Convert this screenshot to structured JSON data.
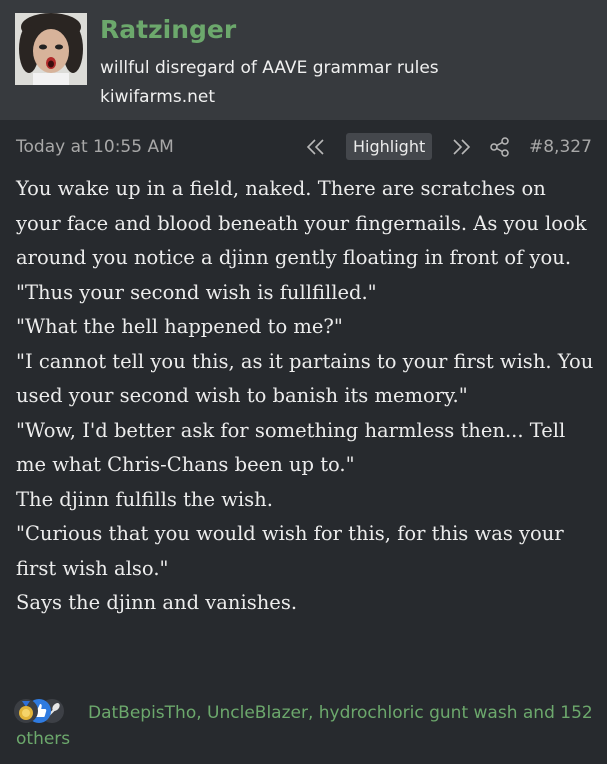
{
  "user": {
    "name": "Ratzinger",
    "title": "willful disregard of AAVE grammar rules",
    "banner": "kiwifarms.net"
  },
  "meta": {
    "timestamp": "Today at 10:55 AM",
    "highlight_label": "Highlight",
    "post_number": "#8,327"
  },
  "body": {
    "paragraphs": [
      "You wake up in a field, naked. There are scratches on your face and blood beneath your fingernails. As you look around you notice a djinn gently floating in front of you.",
      "\"Thus your second wish is fullfilled.\"",
      "\"What the hell happened to me?\"",
      "\"I cannot tell you this, as it partains to your first wish. You used your second wish to banish its memory.\"",
      "\"Wow, I'd better ask for something harmless then... Tell me what Chris-Chans been up to.\"",
      "The djinn fulfills the wish.",
      "\"Curious that you would wish for this, for this was your first wish also.\"",
      "Says the djinn and vanishes."
    ]
  },
  "reactions": {
    "icons": [
      "medal-icon",
      "thumbs-up-icon",
      "spoon-icon"
    ],
    "users": "DatBepisTho, UncleBlazer, hydrochloric gunt wash",
    "connector": " and ",
    "others": "152 others"
  },
  "colors": {
    "accent_green": "#6ca86c",
    "header_bg": "#373a3e",
    "page_bg": "#272a2e"
  }
}
